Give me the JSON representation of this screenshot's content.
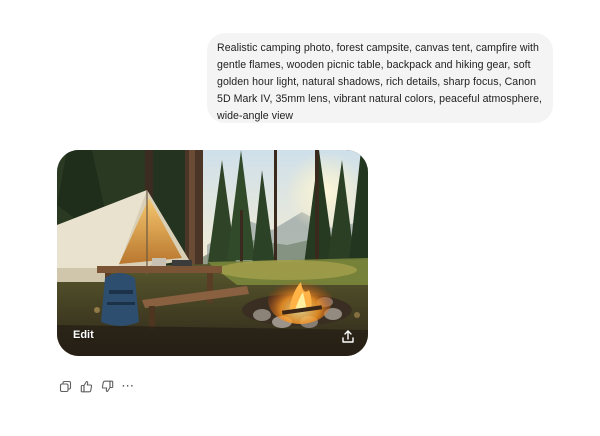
{
  "conversation": {
    "user_message": "Realistic camping photo, forest campsite, canvas tent, campfire with gentle flames, wooden picnic table, backpack and hiking gear, soft golden hour light, natural shadows, rich details, sharp focus, Canon 5D Mark IV, 35mm lens, vibrant natural colors, peaceful atmosphere, wide-angle view",
    "generated_image": {
      "edit_label": "Edit",
      "share_icon": "share-upload-icon"
    },
    "actions": {
      "copy_icon": "copy-icon",
      "like_icon": "thumbs-up-icon",
      "dislike_icon": "thumbs-down-icon",
      "more_icon": "more-dots-icon",
      "more_label": "⋯"
    }
  },
  "colors": {
    "bubble_bg": "#f4f4f4",
    "icon_gray": "#5f5f5f"
  }
}
